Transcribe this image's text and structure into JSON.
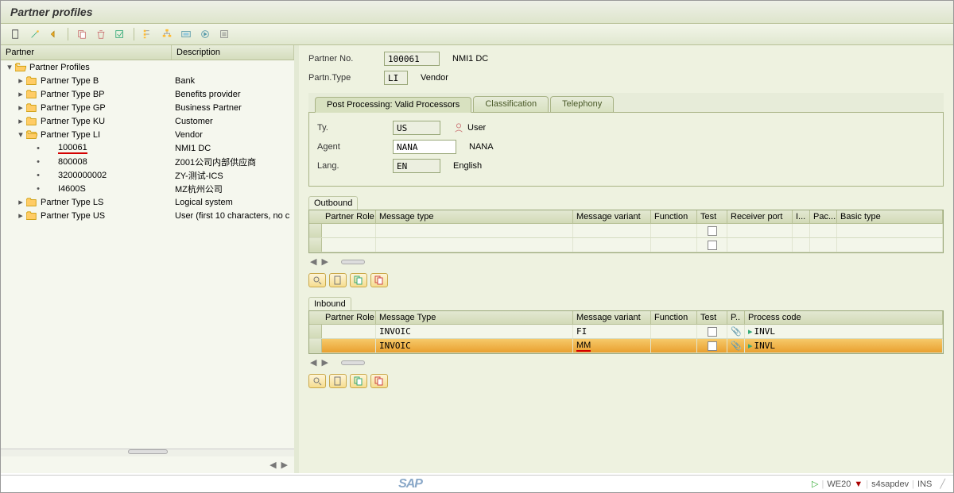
{
  "title": "Partner profiles",
  "tree": {
    "header": {
      "c1": "Partner",
      "c2": "Description"
    },
    "root": {
      "label": "Partner Profiles",
      "desc": ""
    },
    "types": [
      {
        "label": "Partner Type B",
        "desc": "Bank",
        "expanded": false
      },
      {
        "label": "Partner Type BP",
        "desc": "Benefits provider",
        "expanded": false
      },
      {
        "label": "Partner Type GP",
        "desc": "Business Partner",
        "expanded": false
      },
      {
        "label": "Partner Type KU",
        "desc": "Customer",
        "expanded": false
      },
      {
        "label": "Partner Type LI",
        "desc": "Vendor",
        "expanded": true,
        "children": [
          {
            "label": "100061",
            "desc": "NMI1 DC",
            "selected": true
          },
          {
            "label": "800008",
            "desc": "Z001公司内部供应商"
          },
          {
            "label": "3200000002",
            "desc": "ZY-测试-ICS"
          },
          {
            "label": "I4600S",
            "desc": "MZ杭州公司"
          }
        ]
      },
      {
        "label": "Partner Type LS",
        "desc": "Logical system",
        "expanded": false
      },
      {
        "label": "Partner Type US",
        "desc": "User (first 10 characters, no c",
        "expanded": false
      }
    ]
  },
  "header": {
    "partner_no_lbl": "Partner No.",
    "partner_no_val": "100061",
    "partner_no_desc": "NMI1 DC",
    "partn_type_lbl": "Partn.Type",
    "partn_type_val": "LI",
    "partn_type_desc": "Vendor"
  },
  "tabs": {
    "t1": "Post Processing: Valid Processors",
    "t2": "Classification",
    "t3": "Telephony"
  },
  "postproc": {
    "ty_lbl": "Ty.",
    "ty_val": "US",
    "ty_desc": "User",
    "agent_lbl": "Agent",
    "agent_val": "NANA",
    "agent_desc": "NANA",
    "lang_lbl": "Lang.",
    "lang_val": "EN",
    "lang_desc": "English"
  },
  "outbound": {
    "title": "Outbound",
    "cols": {
      "role": "Partner Role",
      "msg": "Message type",
      "var": "Message variant",
      "func": "Function",
      "test": "Test",
      "rport": "Receiver port",
      "i": "I...",
      "pac": "Pac...",
      "btype": "Basic type"
    }
  },
  "inbound": {
    "title": "Inbound",
    "cols": {
      "role": "Partner Role",
      "msg": "Message Type",
      "var": "Message variant",
      "func": "Function",
      "test": "Test",
      "p": "P..",
      "proc": "Process code"
    },
    "rows": [
      {
        "role": "",
        "msg": "INVOIC",
        "var": "FI",
        "func": "",
        "test": false,
        "attach": true,
        "proc": "INVL",
        "hl": false
      },
      {
        "role": "",
        "msg": "INVOIC",
        "var": "MM",
        "func": "",
        "test": false,
        "attach": true,
        "proc": "INVL",
        "hl": true,
        "var_underline": true
      }
    ]
  },
  "status": {
    "tcode": "WE20",
    "system": "s4sapdev",
    "mode": "INS"
  }
}
